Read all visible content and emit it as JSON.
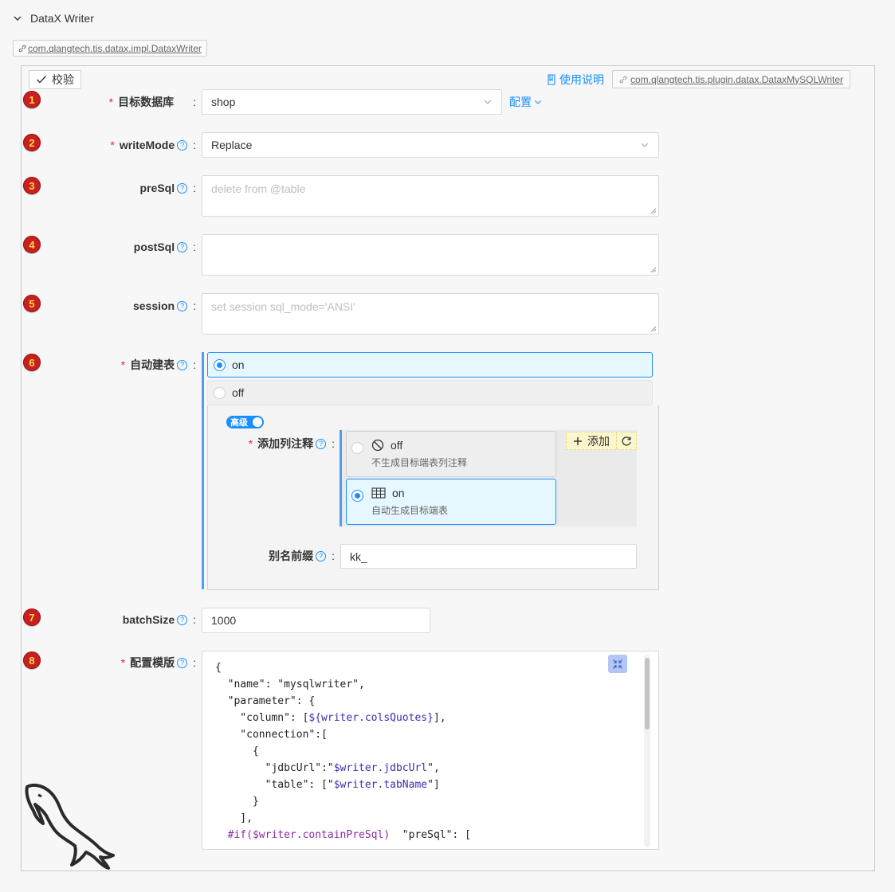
{
  "section": {
    "title": "DataX Writer",
    "class_name": "com.qlangtech.tis.datax.impl.DataxWriter"
  },
  "toolbar": {
    "verify_label": "校验",
    "doc_label": "使用说明",
    "plugin_class": "com.qlangtech.tis.plugin.datax.DataxMySQLWriter"
  },
  "badges": [
    "1",
    "2",
    "3",
    "4",
    "5",
    "6",
    "7",
    "8"
  ],
  "fields": {
    "target_db": {
      "label": "目标数据库",
      "value": "shop",
      "config_label": "配置"
    },
    "write_mode": {
      "label": "writeMode",
      "value": "Replace"
    },
    "pre_sql": {
      "label": "preSql",
      "placeholder": "delete from @table"
    },
    "post_sql": {
      "label": "postSql",
      "placeholder": ""
    },
    "session": {
      "label": "session",
      "placeholder": "set session sql_mode='ANSI'"
    },
    "auto_create": {
      "label": "自动建表",
      "options": [
        "on",
        "off"
      ],
      "selected": "on",
      "advanced_label": "高级",
      "add_comment": {
        "label": "添加列注释",
        "options": [
          {
            "title": "off",
            "desc": "不生成目标端表列注释"
          },
          {
            "title": "on",
            "desc": "自动生成目标端表"
          }
        ],
        "selected": "on",
        "add_label": "添加"
      },
      "alias_prefix": {
        "label": "别名前缀",
        "value": "kk_"
      }
    },
    "batch_size": {
      "label": "batchSize",
      "value": "1000"
    },
    "template": {
      "label": "配置模版",
      "lines": [
        [
          "{"
        ],
        [
          "  \"name\": \"mysqlwriter\","
        ],
        [
          "  \"parameter\": {"
        ],
        [
          "    \"column\": [",
          "${writer.colsQuotes}",
          "],"
        ],
        [
          "    \"connection\":["
        ],
        [
          "      {"
        ],
        [
          "        \"jdbcUrl\":\"",
          "$writer.jdbcUrl",
          "\","
        ],
        [
          "        \"table\": [\"",
          "$writer.tabName",
          "\"]"
        ],
        [
          "      }"
        ],
        [
          "    ],"
        ],
        [
          "",
          "#if($writer.containPreSql)",
          "  \"preSql\": ["
        ]
      ]
    }
  },
  "colors": {
    "accent": "#1890ff",
    "required": "#f5222d",
    "badge": "#c8201e"
  }
}
